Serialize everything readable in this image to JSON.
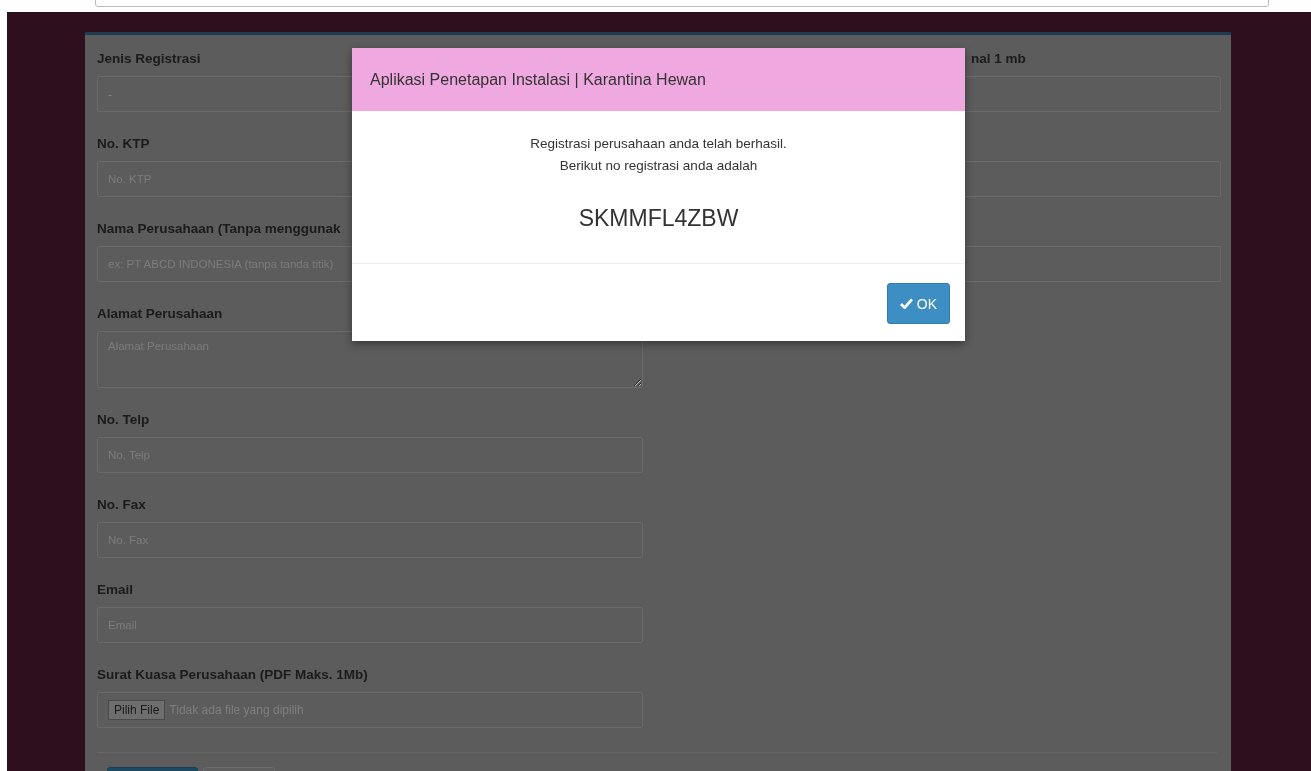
{
  "form": {
    "left_fields": [
      {
        "label": "Jenis Registrasi",
        "kind": "select",
        "value": "-"
      },
      {
        "label": "No. KTP",
        "kind": "input",
        "placeholder": "No. KTP"
      },
      {
        "label": "Nama Perusahaan (Tanpa menggunak",
        "kind": "input",
        "placeholder": "ex: PT ABCD INDONESIA (tanpa tanda titik)"
      },
      {
        "label": "Alamat Perusahaan",
        "kind": "textarea",
        "placeholder": "Alamat Perusahaan"
      },
      {
        "label": "No. Telp",
        "kind": "input",
        "placeholder": "No. Telp"
      },
      {
        "label": "No. Fax",
        "kind": "input",
        "placeholder": "No. Fax"
      },
      {
        "label": "Email",
        "kind": "input",
        "placeholder": "Email"
      },
      {
        "label": "Surat Kuasa Perusahaan (PDF Maks. 1Mb)",
        "kind": "file",
        "button": "Pilih File",
        "status": "Tidak ada file yang dipilih"
      }
    ],
    "right_label": "nal 1 mb",
    "right_fields": [
      {
        "kind": "input"
      },
      {
        "kind": "input"
      },
      {
        "kind": "input"
      }
    ],
    "buttons": [
      {
        "kind": "primary"
      },
      {
        "kind": "default"
      }
    ]
  },
  "modal": {
    "title": "Aplikasi Penetapan Instalasi | Karantina Hewan",
    "message_lines": [
      "Registrasi perusahaan anda telah berhasil.",
      "Berikut no registrasi anda adalah"
    ],
    "registration_number": "SKMMFL4ZBW",
    "ok_button": "OK"
  }
}
